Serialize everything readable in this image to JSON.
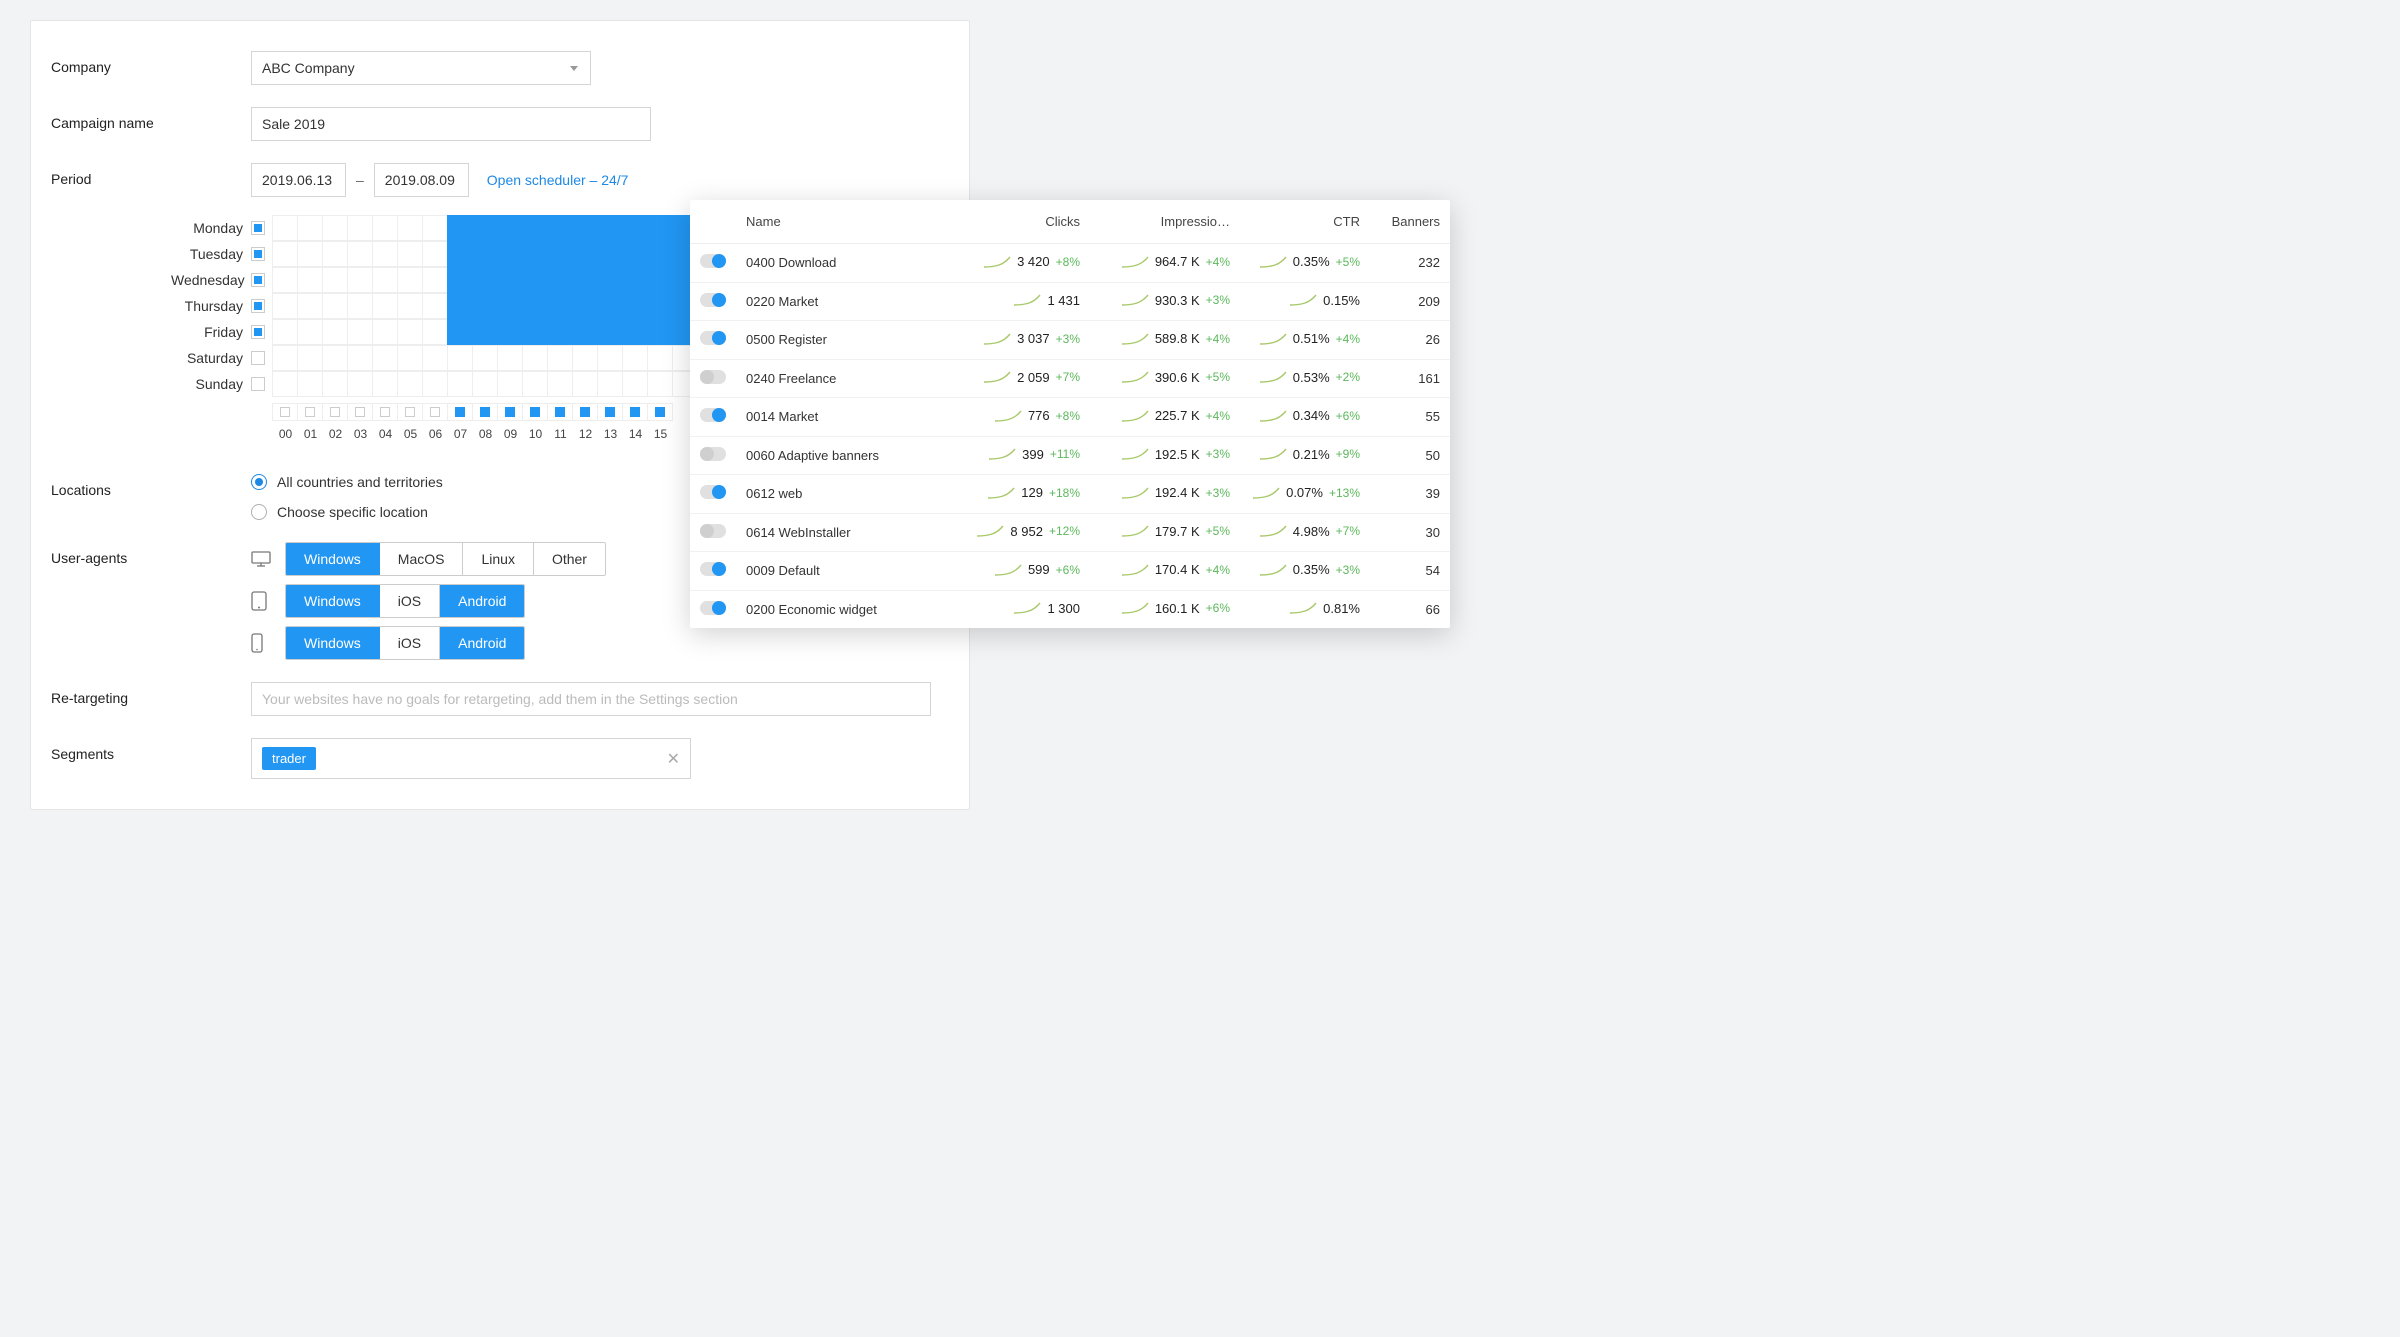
{
  "form": {
    "company_label": "Company",
    "company_value": "ABC Company",
    "campaign_label": "Campaign name",
    "campaign_value": "Sale 2019",
    "period_label": "Period",
    "period_from": "2019.06.13",
    "period_to": "2019.08.09",
    "period_dash": "–",
    "scheduler_link": "Open scheduler – 24/7",
    "locations_label": "Locations",
    "locations_all": "All countries and territories",
    "locations_specific": "Choose specific location",
    "ua_label": "User-agents",
    "ua_desktop": [
      "Windows",
      "MacOS",
      "Linux",
      "Other"
    ],
    "ua_desktop_active": [
      true,
      false,
      false,
      false
    ],
    "ua_tablet": [
      "Windows",
      "iOS",
      "Android"
    ],
    "ua_tablet_active": [
      true,
      false,
      true
    ],
    "ua_mobile": [
      "Windows",
      "iOS",
      "Android"
    ],
    "ua_mobile_active": [
      true,
      false,
      true
    ],
    "retarget_label": "Re-targeting",
    "retarget_placeholder": "Your websites have no goals for retargeting, add them in the Settings section",
    "segments_label": "Segments",
    "segments_tag": "trader"
  },
  "scheduler": {
    "days": [
      "Monday",
      "Tuesday",
      "Wednesday",
      "Thursday",
      "Friday",
      "Saturday",
      "Sunday"
    ],
    "days_on": [
      true,
      true,
      true,
      true,
      true,
      false,
      false
    ],
    "hours_visible": [
      "00",
      "01",
      "02",
      "03",
      "04",
      "05",
      "06",
      "07",
      "08",
      "09",
      "10",
      "11",
      "12",
      "13",
      "14",
      "15"
    ],
    "hours_on": [
      false,
      false,
      false,
      false,
      false,
      false,
      false,
      true,
      true,
      true,
      true,
      true,
      true,
      true,
      true,
      true
    ],
    "fill_cols": [
      7,
      8,
      9,
      10,
      11,
      12,
      13,
      14,
      15,
      16,
      17,
      18,
      19
    ]
  },
  "table": {
    "headers": [
      "Name",
      "Clicks",
      "Impressio…",
      "CTR",
      "Banners"
    ],
    "rows": [
      {
        "on": true,
        "name": "0400 Download",
        "clicks": "3 420",
        "clicks_d": "+8%",
        "impr": "964.7 K",
        "impr_d": "+4%",
        "ctr": "0.35%",
        "ctr_d": "+5%",
        "banners": "232"
      },
      {
        "on": true,
        "name": "0220 Market",
        "clicks": "1 431",
        "clicks_d": "",
        "impr": "930.3 K",
        "impr_d": "+3%",
        "ctr": "0.15%",
        "ctr_d": "",
        "banners": "209"
      },
      {
        "on": true,
        "name": "0500 Register",
        "clicks": "3 037",
        "clicks_d": "+3%",
        "impr": "589.8 K",
        "impr_d": "+4%",
        "ctr": "0.51%",
        "ctr_d": "+4%",
        "banners": "26"
      },
      {
        "on": false,
        "name": "0240 Freelance",
        "clicks": "2 059",
        "clicks_d": "+7%",
        "impr": "390.6 K",
        "impr_d": "+5%",
        "ctr": "0.53%",
        "ctr_d": "+2%",
        "banners": "161"
      },
      {
        "on": true,
        "name": "0014 Market",
        "clicks": "776",
        "clicks_d": "+8%",
        "impr": "225.7 K",
        "impr_d": "+4%",
        "ctr": "0.34%",
        "ctr_d": "+6%",
        "banners": "55"
      },
      {
        "on": false,
        "name": "0060 Adaptive banners",
        "clicks": "399",
        "clicks_d": "+11%",
        "impr": "192.5 K",
        "impr_d": "+3%",
        "ctr": "0.21%",
        "ctr_d": "+9%",
        "banners": "50"
      },
      {
        "on": true,
        "name": "0612 web",
        "clicks": "129",
        "clicks_d": "+18%",
        "impr": "192.4 K",
        "impr_d": "+3%",
        "ctr": "0.07%",
        "ctr_d": "+13%",
        "banners": "39"
      },
      {
        "on": false,
        "name": "0614 WebInstaller",
        "clicks": "8 952",
        "clicks_d": "+12%",
        "impr": "179.7 K",
        "impr_d": "+5%",
        "ctr": "4.98%",
        "ctr_d": "+7%",
        "banners": "30"
      },
      {
        "on": true,
        "name": "0009 Default",
        "clicks": "599",
        "clicks_d": "+6%",
        "impr": "170.4 K",
        "impr_d": "+4%",
        "ctr": "0.35%",
        "ctr_d": "+3%",
        "banners": "54"
      },
      {
        "on": true,
        "name": "0200 Economic widget",
        "clicks": "1 300",
        "clicks_d": "",
        "impr": "160.1 K",
        "impr_d": "+6%",
        "ctr": "0.81%",
        "ctr_d": "",
        "banners": "66"
      }
    ]
  }
}
